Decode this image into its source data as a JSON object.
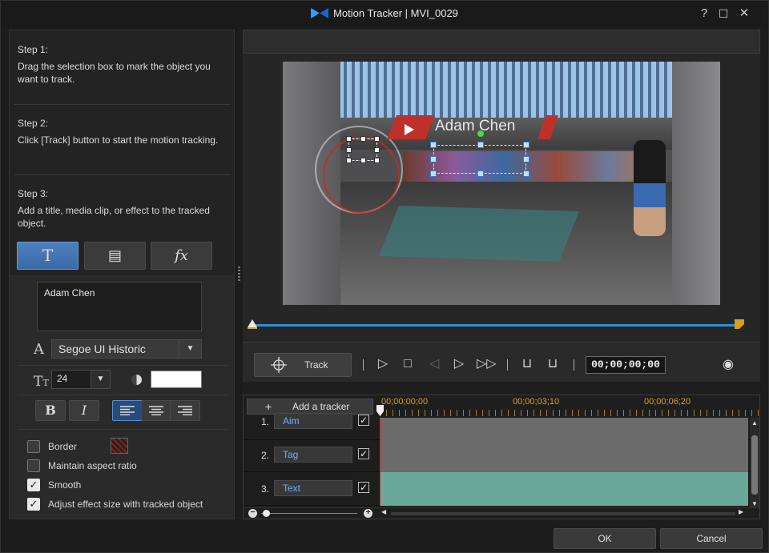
{
  "window": {
    "title": "Motion Tracker  |  MVI_0029",
    "help_label": "?",
    "maximize_label": "☐",
    "close_label": "✕"
  },
  "steps": [
    {
      "heading": "Step 1:",
      "text": "Drag the selection box to mark the object you want to track."
    },
    {
      "heading": "Step 2:",
      "text": "Click [Track] button to start the motion tracking."
    },
    {
      "heading": "Step 3:",
      "text": "Add a title, media clip, or effect to the tracked object."
    }
  ],
  "object_tabs": [
    {
      "name": "title",
      "label": "T",
      "active": true
    },
    {
      "name": "media-clip",
      "label": "▤",
      "active": false
    },
    {
      "name": "effect",
      "label": "fx",
      "active": false
    }
  ],
  "title_settings": {
    "text_value": "Adam Chen",
    "font_glyph": "A",
    "font_value": "Segoe UI Historic",
    "size_glyph": "TT",
    "size_value": "24",
    "text_color": "#ffffff",
    "bold_label": "B",
    "italic_label": "I",
    "alignment_selected": "left"
  },
  "options": {
    "border_label": "Border",
    "border_checked": false,
    "aspect_label": "Maintain aspect ratio",
    "aspect_checked": false,
    "smooth_label": "Smooth",
    "smooth_checked": true,
    "adjust_label": "Adjust effect size with tracked object",
    "adjust_checked": true
  },
  "preview": {
    "overlay_title": "Adam Chen",
    "accent_color": "#c0302a",
    "progress_color": "#2b8fd8"
  },
  "controls": {
    "track_label": "Track",
    "timecode": "00;00;00;00"
  },
  "timeline": {
    "add_tracker_label": "Add a tracker",
    "ruler_labels": [
      "00;00;00;00",
      "00;00;03;10",
      "00;00;06;20"
    ],
    "tracks": [
      {
        "num": "1.",
        "name": "Aim",
        "checked": true,
        "clip_color": "#6b6b6b"
      },
      {
        "num": "2.",
        "name": "Tag",
        "checked": true,
        "clip_color": "#6b6b6b"
      },
      {
        "num": "3.",
        "name": "Text",
        "checked": true,
        "clip_color": "#6aa89a"
      }
    ]
  },
  "footer": {
    "ok_label": "OK",
    "cancel_label": "Cancel"
  }
}
